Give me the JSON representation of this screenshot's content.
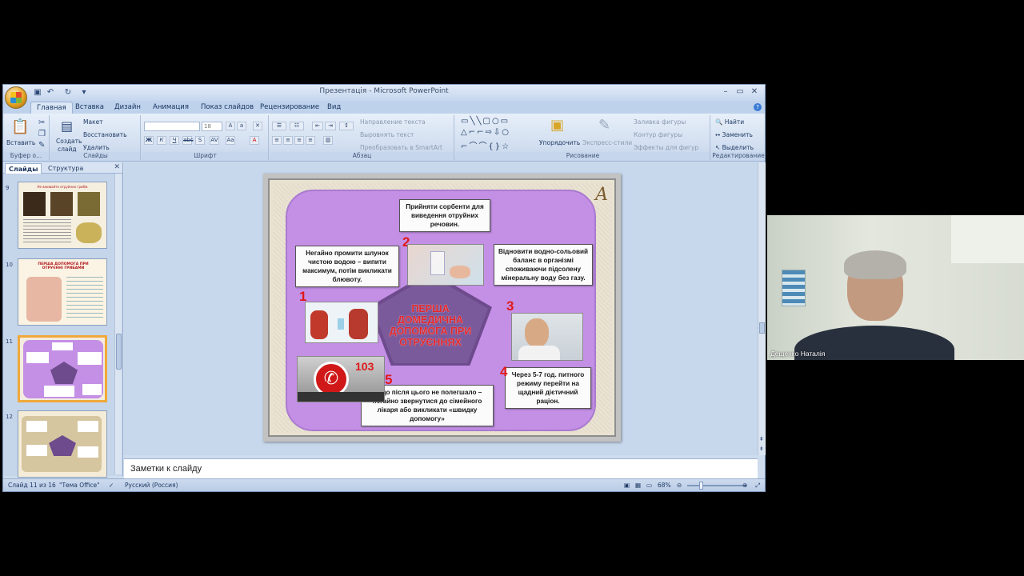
{
  "window": {
    "title": "Презентація - Microsoft PowerPoint",
    "tabs": [
      "Главная",
      "Вставка",
      "Дизайн",
      "Анимация",
      "Показ слайдов",
      "Рецензирование",
      "Вид"
    ]
  },
  "ribbon": {
    "clipboard": {
      "label": "Буфер о...",
      "paste": "Вставить"
    },
    "slides": {
      "label": "Слайды",
      "create": "Создать",
      "create2": "слайд",
      "layout": "Макет",
      "restore": "Восстановить",
      "delete": "Удалить"
    },
    "font": {
      "label": "Шрифт",
      "size": "18"
    },
    "paragraph": {
      "label": "Абзац",
      "text_direction": "Направление текста",
      "align_text": "Выровнять текст",
      "smartart": "Преобразовать в SmartArt"
    },
    "drawing": {
      "label": "Рисование",
      "arrange": "Упорядочить",
      "quick_styles": "Экспресс-стили",
      "fill": "Заливка фигуры",
      "outline": "Контур фигуры",
      "effects": "Эффекты для фигур"
    },
    "editing": {
      "label": "Редактирование",
      "find": "Найти",
      "replace": "Заменить",
      "select": "Выделить"
    }
  },
  "pane": {
    "tab_slides": "Слайды",
    "tab_outline": "Структура",
    "thumbs": [
      {
        "num": "9",
        "title": "Не вживайте отруйних грибів"
      },
      {
        "num": "10",
        "title": "ПЕРША ДОПОМОГА ПРИ ОТРУЄННІ ГРИБАМИ"
      },
      {
        "num": "11",
        "title": ""
      },
      {
        "num": "12",
        "title": ""
      }
    ]
  },
  "slide": {
    "center_title": "ПЕРША ДОМЕДИЧНА ДОПОМОГА ПРИ ОТРУЄННЯХ",
    "step1": "Негайно промити шлунок чистою водою – випити максимум, потім викликати блювоту.",
    "step2": "Прийняти сорбенти для виведення отруйних речовин.",
    "step3": "Відновити водно-сольовий баланс в організмі споживаючи підсолену мінеральну воду без газу.",
    "step4": "Через 5-7 год. питного режиму перейти на щадний дієтичний раціон.",
    "step5": "Якщо після цього не полегшало – негайно звернутися до сімейного лікаря або викликати «швидку допомогу»",
    "n1": "1",
    "n2": "2",
    "n3": "3",
    "n4": "4",
    "n5": "5",
    "phone_number": "103"
  },
  "notes_placeholder": "Заметки к слайду",
  "status": {
    "slide_of": "Слайд 11 из 16",
    "theme": "\"Тема Office\"",
    "language": "Русский (Россия)",
    "zoom": "68%"
  },
  "webcam": {
    "name": "Дещенко Наталія"
  }
}
